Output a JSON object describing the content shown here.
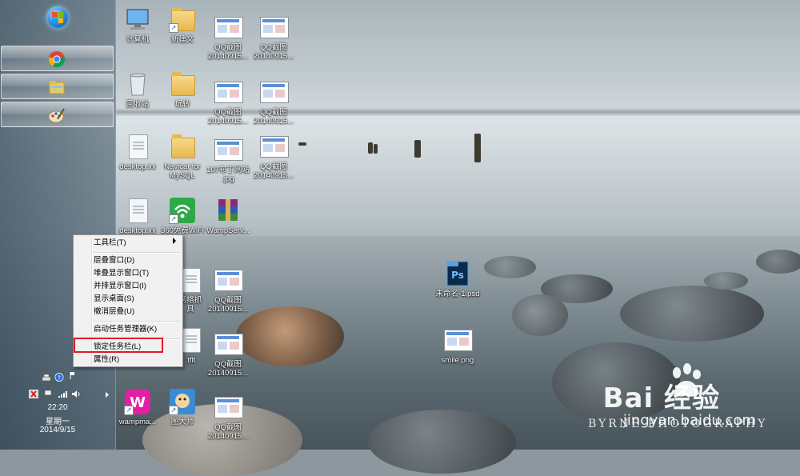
{
  "taskbar": {
    "start_button": "windows-start-icon",
    "pinned": [
      {
        "name": "chrome",
        "icon": "chrome-icon"
      },
      {
        "name": "explorer",
        "icon": "folder-explorer-icon"
      },
      {
        "name": "paint",
        "icon": "paint-icon"
      }
    ],
    "clock": {
      "time": "22:20",
      "weekday": "星期一",
      "date": "2014/9/15"
    }
  },
  "desktop_icons": [
    {
      "label": "计算机",
      "icon": "computer-icon"
    },
    {
      "label": "新建文",
      "icon": "folder-icon"
    },
    {
      "label": "QQ截图\n20140915...",
      "icon": "image-file-icon"
    },
    {
      "label": "QQ截图\n20140915...",
      "icon": "image-file-icon"
    },
    {
      "label": "回收站",
      "icon": "recycle-bin-icon"
    },
    {
      "label": "玩转",
      "icon": "folder-icon"
    },
    {
      "label": "QQ截图\n20140915...",
      "icon": "image-file-icon"
    },
    {
      "label": "QQ截图\n20140915...",
      "icon": "image-file-icon"
    },
    {
      "label": "desktop.ini",
      "icon": "ini-file-icon"
    },
    {
      "label": "Navicat for\nMySQL",
      "icon": "folder-icon"
    },
    {
      "label": "107布丁网站\n.jpg",
      "icon": "image-file-icon"
    },
    {
      "label": "QQ截图\n20140915...",
      "icon": "image-file-icon"
    },
    {
      "label": "desktop.ini",
      "icon": "ini-file-icon"
    },
    {
      "label": "360免费WiFi",
      "icon": "wifi-icon"
    },
    {
      "label": "WampServ...",
      "icon": "winrar-icon"
    },
    {
      "label": "网络抓\n具",
      "icon": "tool-icon"
    },
    {
      "label": "QQ截图\n20140915...",
      "icon": "image-file-icon"
    },
    {
      "label": "未命名-1.psd",
      "icon": "psd-file-icon"
    },
    {
      "label": ".tflt",
      "icon": "file-icon"
    },
    {
      "label": "QQ截图\n20140915...",
      "icon": "image-file-icon"
    },
    {
      "label": "smile.png",
      "icon": "image-file-icon"
    },
    {
      "label": "wampma...",
      "icon": "wamp-icon"
    },
    {
      "label": "图大师",
      "icon": "app-icon"
    },
    {
      "label": "QQ截图\n20140915...",
      "icon": "image-file-icon"
    }
  ],
  "context_menu": {
    "items": [
      {
        "label": "工具栏(T)",
        "submenu": true
      },
      {
        "label": "层叠窗口(D)"
      },
      {
        "label": "堆叠显示窗口(T)"
      },
      {
        "label": "并排显示窗口(I)"
      },
      {
        "label": "显示桌面(S)"
      },
      {
        "label": "撤消层叠(U)"
      },
      {
        "label": "启动任务管理器(K)"
      },
      {
        "label": "锁定任务栏(L)",
        "highlighted": true
      },
      {
        "label": "属性(R)"
      }
    ],
    "highlight_color": "#e0192b"
  },
  "watermark": {
    "brand": "Bai 经验",
    "url": "jingyan.baidu.com",
    "photo_credit": "BYRNE PHOTOGRAPHY"
  }
}
